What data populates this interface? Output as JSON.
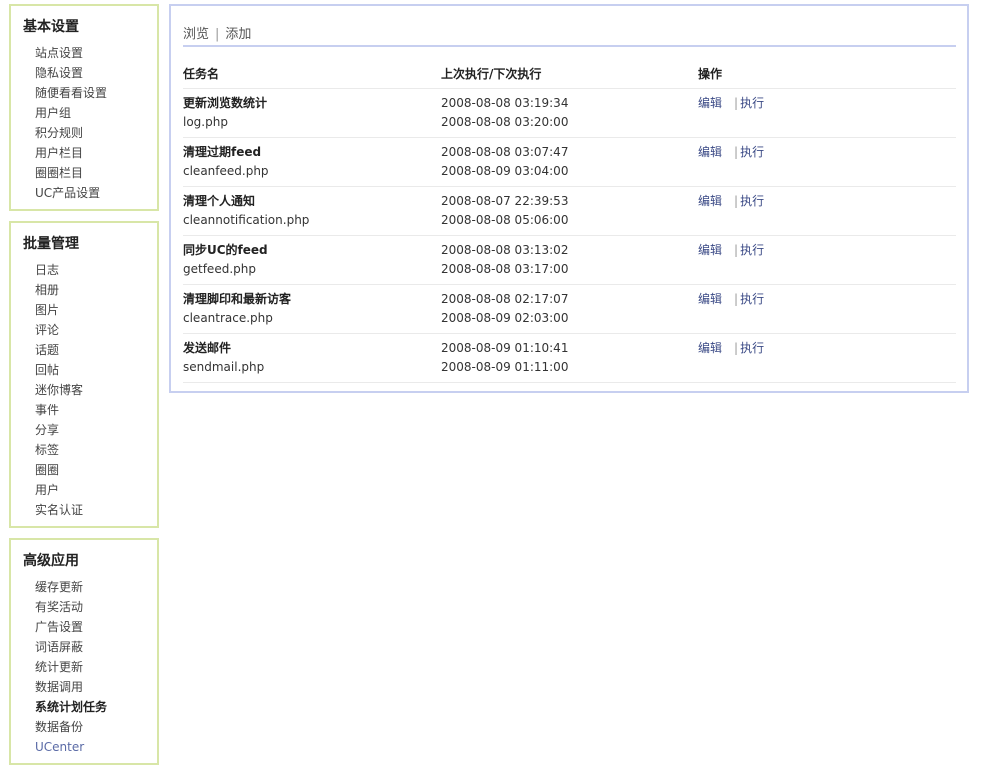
{
  "sidebar": {
    "sections": [
      {
        "title": "基本设置",
        "items": [
          "站点设置",
          "隐私设置",
          "随便看看设置",
          "用户组",
          "积分规则",
          "用户栏目",
          "圈圈栏目",
          "UC产品设置"
        ]
      },
      {
        "title": "批量管理",
        "items": [
          "日志",
          "相册",
          "图片",
          "评论",
          "话题",
          "回帖",
          "迷你博客",
          "事件",
          "分享",
          "标签",
          "圈圈",
          "用户",
          "实名认证"
        ]
      },
      {
        "title": "高级应用",
        "items": [
          "缓存更新",
          "有奖活动",
          "广告设置",
          "词语屏蔽",
          "统计更新",
          "数据调用",
          "系统计划任务",
          "数据备份",
          "UCenter"
        ]
      }
    ]
  },
  "tabs": {
    "browse": "浏览",
    "separator": "|",
    "add": "添加"
  },
  "table": {
    "headers": [
      "任务名",
      "上次执行/下次执行",
      "操作"
    ],
    "edit_label": "编辑",
    "op_separator": "|",
    "run_label": "执行",
    "rows": [
      {
        "name": "更新浏览数统计",
        "file": "log.php",
        "last": "2008-08-08 03:19:34",
        "next": "2008-08-08 03:20:00"
      },
      {
        "name": "清理过期feed",
        "file": "cleanfeed.php",
        "last": "2008-08-08 03:07:47",
        "next": "2008-08-09 03:04:00"
      },
      {
        "name": "清理个人通知",
        "file": "cleannotification.php",
        "last": "2008-08-07 22:39:53",
        "next": "2008-08-08 05:06:00"
      },
      {
        "name": "同步UC的feed",
        "file": "getfeed.php",
        "last": "2008-08-08 03:13:02",
        "next": "2008-08-08 03:17:00"
      },
      {
        "name": "清理脚印和最新访客",
        "file": "cleantrace.php",
        "last": "2008-08-08 02:17:07",
        "next": "2008-08-09 02:03:00"
      },
      {
        "name": "发送邮件",
        "file": "sendmail.php",
        "last": "2008-08-09 01:10:41",
        "next": "2008-08-09 01:11:00"
      }
    ]
  }
}
